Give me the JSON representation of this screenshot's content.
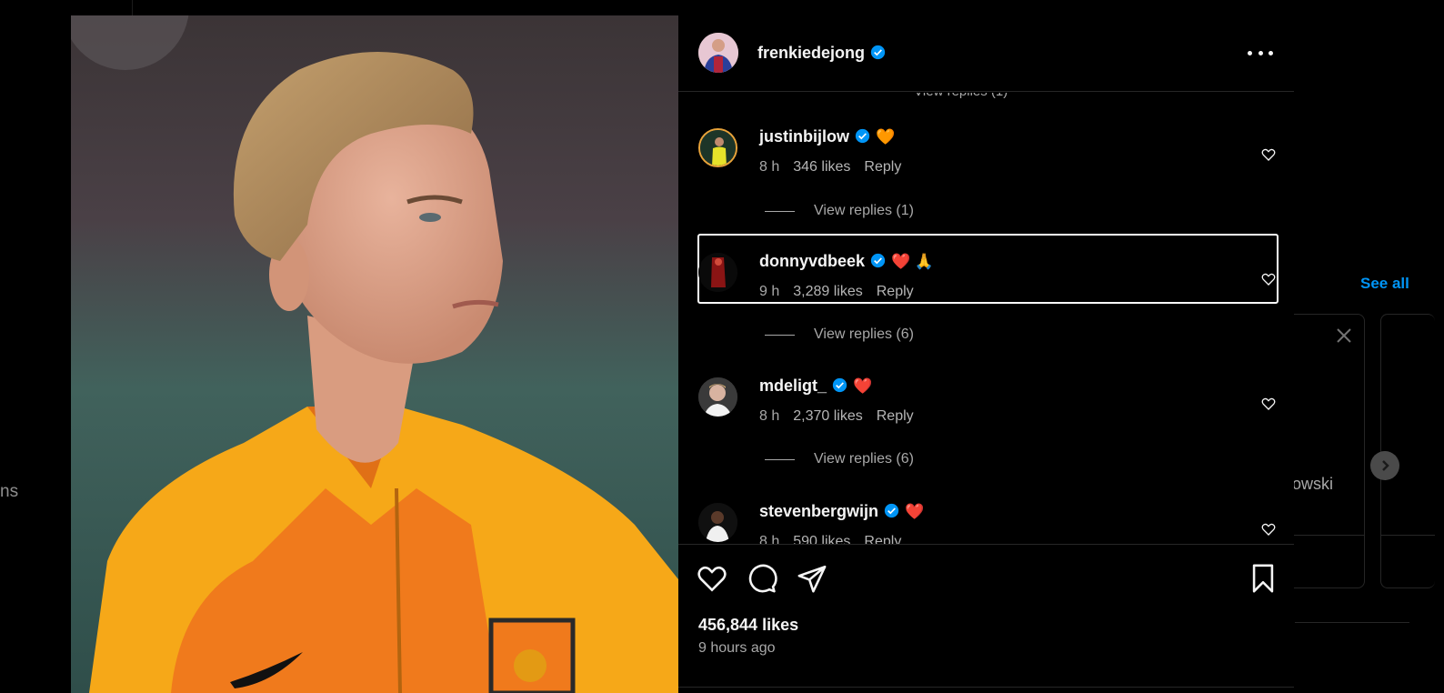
{
  "background": {
    "left_text": "ns",
    "see_all": "See all",
    "suggestion_name": "owski"
  },
  "post": {
    "username": "frenkiedejong",
    "likes": "456,844 likes",
    "time_ago": "9 hours ago"
  },
  "comments": [
    {
      "username": "justinbijlow",
      "emoji": "🧡",
      "time": "8 h",
      "likes": "346 likes",
      "reply": "Reply",
      "view_replies": "View replies (1)"
    },
    {
      "username": "donnyvdbeek",
      "emoji": "❤️ 🙏",
      "time": "9 h",
      "likes": "3,289 likes",
      "reply": "Reply",
      "view_replies": "View replies (6)"
    },
    {
      "username": "mdeligt_",
      "emoji": "❤️",
      "time": "8 h",
      "likes": "2,370 likes",
      "reply": "Reply",
      "view_replies": "View replies (6)"
    },
    {
      "username": "stevenbergwijn",
      "emoji": "❤️",
      "time": "8 h",
      "likes": "590 likes",
      "reply": "Reply"
    }
  ],
  "colors": {
    "verified": "#0095f6",
    "link": "#0095f6",
    "jersey_orange": "#f07a1c",
    "jersey_yellow": "#f6a818"
  },
  "icons": {
    "like": "heart-outline-icon",
    "comment": "speech-bubble-icon",
    "share": "paper-plane-icon",
    "save": "bookmark-icon",
    "more": "more-horizontal-icon"
  }
}
